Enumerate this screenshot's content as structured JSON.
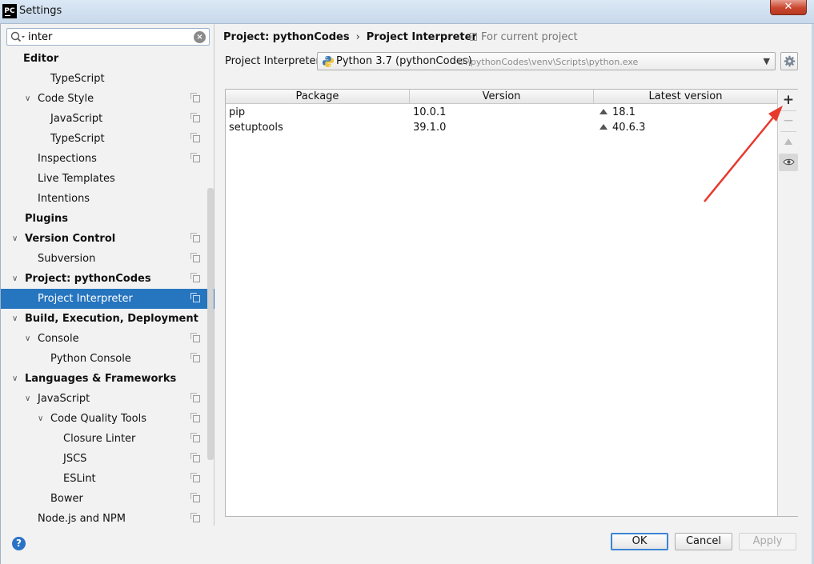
{
  "window": {
    "title": "Settings",
    "logo_text": "PC",
    "close_glyph": "✕"
  },
  "search": {
    "value": "inter",
    "clear_glyph": "×"
  },
  "tree": [
    {
      "label": "Editor",
      "level": 0,
      "bold": true,
      "chevron": "none",
      "copy": false
    },
    {
      "label": "TypeScript",
      "level": 2,
      "bold": false,
      "chevron": "none",
      "copy": false
    },
    {
      "label": "Code Style",
      "level": 1,
      "bold": false,
      "chevron": "expanded",
      "copy": true
    },
    {
      "label": "JavaScript",
      "level": 2,
      "bold": false,
      "chevron": "none",
      "copy": true
    },
    {
      "label": "TypeScript",
      "level": 2,
      "bold": false,
      "chevron": "none",
      "copy": true
    },
    {
      "label": "Inspections",
      "level": 1,
      "bold": false,
      "chevron": "none",
      "copy": true
    },
    {
      "label": "Live Templates",
      "level": 1,
      "bold": false,
      "chevron": "none",
      "copy": false
    },
    {
      "label": "Intentions",
      "level": 1,
      "bold": false,
      "chevron": "none",
      "copy": false
    },
    {
      "label": "Plugins",
      "level": 0,
      "bold": true,
      "chevron": "none",
      "copy": false
    },
    {
      "label": "Version Control",
      "level": 0,
      "bold": true,
      "chevron": "expanded",
      "copy": true
    },
    {
      "label": "Subversion",
      "level": 1,
      "bold": false,
      "chevron": "none",
      "copy": true
    },
    {
      "label": "Project: pythonCodes",
      "level": 0,
      "bold": true,
      "chevron": "expanded",
      "copy": true
    },
    {
      "label": "Project Interpreter",
      "level": 1,
      "bold": false,
      "chevron": "none",
      "copy": true,
      "selected": true
    },
    {
      "label": "Build, Execution, Deployment",
      "level": 0,
      "bold": true,
      "chevron": "expanded",
      "copy": false
    },
    {
      "label": "Console",
      "level": 1,
      "bold": false,
      "chevron": "expanded",
      "copy": true
    },
    {
      "label": "Python Console",
      "level": 2,
      "bold": false,
      "chevron": "none",
      "copy": true
    },
    {
      "label": "Languages & Frameworks",
      "level": 0,
      "bold": true,
      "chevron": "expanded",
      "copy": false
    },
    {
      "label": "JavaScript",
      "level": 1,
      "bold": false,
      "chevron": "expanded",
      "copy": true
    },
    {
      "label": "Code Quality Tools",
      "level": 2,
      "bold": false,
      "chevron": "expanded",
      "copy": true
    },
    {
      "label": "Closure Linter",
      "level": 3,
      "bold": false,
      "chevron": "none",
      "copy": true
    },
    {
      "label": "JSCS",
      "level": 3,
      "bold": false,
      "chevron": "none",
      "copy": true
    },
    {
      "label": "ESLint",
      "level": 3,
      "bold": false,
      "chevron": "none",
      "copy": true
    },
    {
      "label": "Bower",
      "level": 2,
      "bold": false,
      "chevron": "none",
      "copy": true
    },
    {
      "label": "Node.js and NPM",
      "level": 1,
      "bold": false,
      "chevron": "none",
      "copy": true
    }
  ],
  "breadcrumb": {
    "parent": "Project: pythonCodes",
    "separator": "›",
    "current": "Project Interpreter"
  },
  "scope": {
    "label": "For current project"
  },
  "interpreter": {
    "label": "Project Interpreter:",
    "name": "Python 3.7 (pythonCodes)",
    "path": "D:\\pythonCodes\\venv\\Scripts\\python.exe",
    "arrow": "▼"
  },
  "packages": {
    "columns": [
      "Package",
      "Version",
      "Latest version"
    ],
    "rows": [
      {
        "package": "pip",
        "version": "10.0.1",
        "latest": "18.1"
      },
      {
        "package": "setuptools",
        "version": "39.1.0",
        "latest": "40.6.3"
      }
    ],
    "toolbar": {
      "add": "+",
      "remove": "−"
    }
  },
  "footer": {
    "help": "?",
    "ok": "OK",
    "cancel": "Cancel",
    "apply": "Apply"
  },
  "colors": {
    "selection": "#2675bf",
    "annotation_arrow": "#e8392d"
  }
}
